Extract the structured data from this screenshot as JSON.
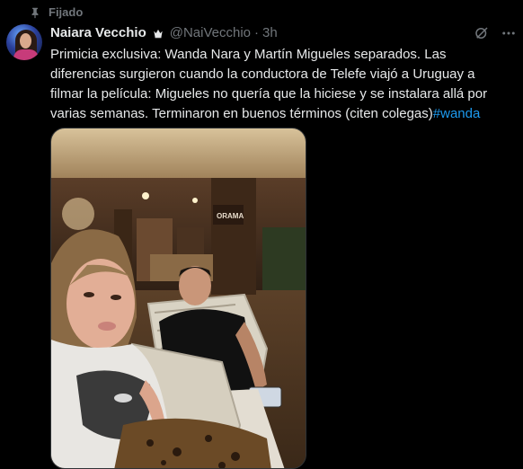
{
  "pinned": {
    "label": "Fijado",
    "icon": "pin-icon"
  },
  "author": {
    "name": "Naiara Vecchio",
    "badge_icon": "crown-icon",
    "handle": "@NaiVecchio",
    "separator": "·",
    "time": "3h",
    "avatar_icon": "avatar"
  },
  "actions": {
    "grok_icon": "grok-icon",
    "more_icon": "more-icon"
  },
  "tweet": {
    "text": "Primicia exclusiva: Wanda Nara y Martín Migueles separados. Las diferencias surgieron cuando la conductora de Telefe viajó a Uruguay a filmar la película: Migueles no quería que la hiciese y se instalara allá por varias semanas. Terminaron en buenos términos (citen colegas)",
    "hashtag": "#wanda"
  },
  "media": {
    "sign_text": "ORAMA"
  },
  "colors": {
    "background": "#000000",
    "text": "#e7e9ea",
    "muted": "#71767b",
    "link": "#1d9bf0",
    "border": "#2f3336"
  }
}
